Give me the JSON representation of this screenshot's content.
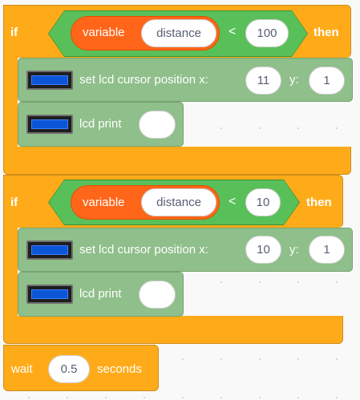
{
  "blocks": {
    "if1": {
      "keyword": "if",
      "condition": {
        "variable_label": "variable",
        "variable_name": "distance",
        "operator": "<",
        "value": "100"
      },
      "then_label": "then",
      "body": [
        {
          "type": "set_cursor",
          "label": "set lcd cursor position x:",
          "x": "11",
          "y_label": "y:",
          "y": "1"
        },
        {
          "type": "print",
          "label": "lcd print",
          "value": ""
        }
      ]
    },
    "if2": {
      "keyword": "if",
      "condition": {
        "variable_label": "variable",
        "variable_name": "distance",
        "operator": "<",
        "value": "10"
      },
      "then_label": "then",
      "body": [
        {
          "type": "set_cursor",
          "label": "set lcd cursor position x:",
          "x": "10",
          "y_label": "y:",
          "y": "1"
        },
        {
          "type": "print",
          "label": "lcd print",
          "value": ""
        }
      ]
    },
    "wait": {
      "label": "wait",
      "value": "0.5",
      "unit": "seconds"
    }
  },
  "icons": {
    "lcd": "lcd-display-icon"
  },
  "colors": {
    "control": "#ffab19",
    "operator": "#59c059",
    "variable": "#ff661a",
    "extension": "#8fbf8a",
    "canvas": "#f9f9f9"
  }
}
